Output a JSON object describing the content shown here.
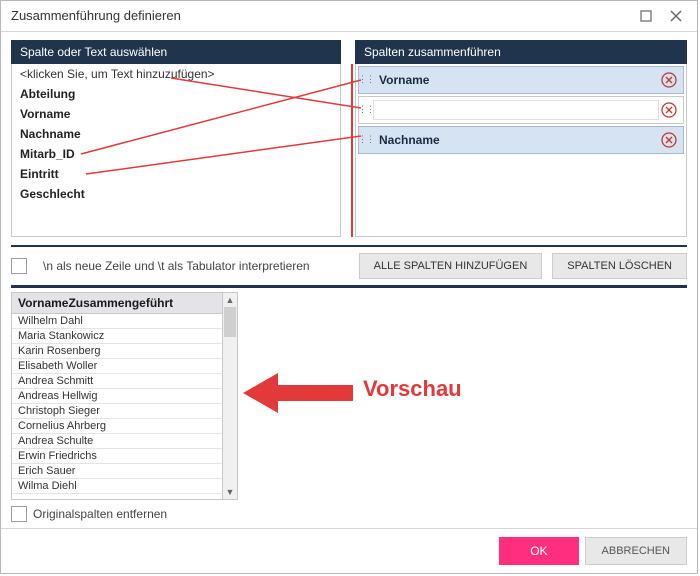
{
  "window": {
    "title": "Zusammenführung definieren"
  },
  "left_panel": {
    "header": "Spalte oder Text auswählen",
    "placeholder": "<klicken Sie, um Text hinzuzufügen>",
    "items": [
      "Abteilung",
      "Vorname",
      "Nachname",
      "Mitarb_ID",
      "Eintritt",
      "Geschlecht"
    ]
  },
  "right_panel": {
    "header": "Spalten zusammenführen",
    "rows": [
      {
        "label": "Vorname",
        "empty": false
      },
      {
        "label": "",
        "empty": true
      },
      {
        "label": "Nachname",
        "empty": false
      }
    ]
  },
  "options": {
    "interpret_newline_tab": "\\n als neue Zeile und \\t als Tabulator interpretieren",
    "add_all": "ALLE SPALTEN HINZUFÜGEN",
    "clear_all": "SPALTEN LÖSCHEN",
    "remove_originals": "Originalspalten entfernen"
  },
  "preview": {
    "header": "VornameZusammengeführt",
    "rows": [
      "Wilhelm Dahl",
      "Maria Stankowicz",
      "Karin Rosenberg",
      "Elisabeth Woller",
      "Andrea Schmitt",
      "Andreas Hellwig",
      "Christoph Sieger",
      "Cornelius Ahrberg",
      "Andrea Schulte",
      "Erwin Friedrichs",
      "Erich Sauer",
      "Wilma Diehl"
    ],
    "annotation_label": "Vorschau"
  },
  "footer": {
    "ok": "OK",
    "cancel": "ABBRECHEN"
  }
}
